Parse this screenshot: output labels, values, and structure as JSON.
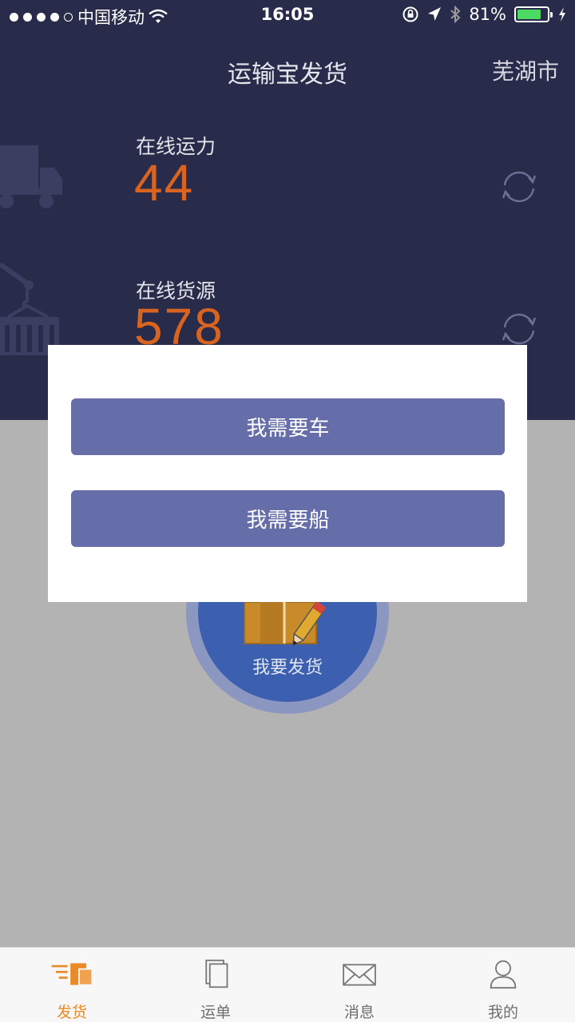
{
  "status_bar": {
    "carrier": "中国移动",
    "time": "16:05",
    "battery_percent": "81%",
    "battery_level": 0.81
  },
  "nav": {
    "title": "运输宝发货",
    "city": "芜湖市"
  },
  "stats": {
    "capacity_label": "在线运力",
    "capacity_value": "44",
    "cargo_label": "在线货源",
    "cargo_value": "578"
  },
  "main": {
    "ship_label": "我要发货"
  },
  "dialog": {
    "need_truck": "我需要车",
    "need_ship": "我需要船"
  },
  "tabbar": {
    "items": [
      {
        "label": "发货",
        "icon": "ship-goods-icon",
        "active": true
      },
      {
        "label": "运单",
        "icon": "waybill-icon",
        "active": false
      },
      {
        "label": "消息",
        "icon": "mail-icon",
        "active": false
      },
      {
        "label": "我的",
        "icon": "user-icon",
        "active": false
      }
    ]
  },
  "colors": {
    "header_bg": "#282c4a",
    "accent_orange": "#d9641f",
    "dialog_button": "#666ea9",
    "tab_active": "#ea8a26"
  }
}
